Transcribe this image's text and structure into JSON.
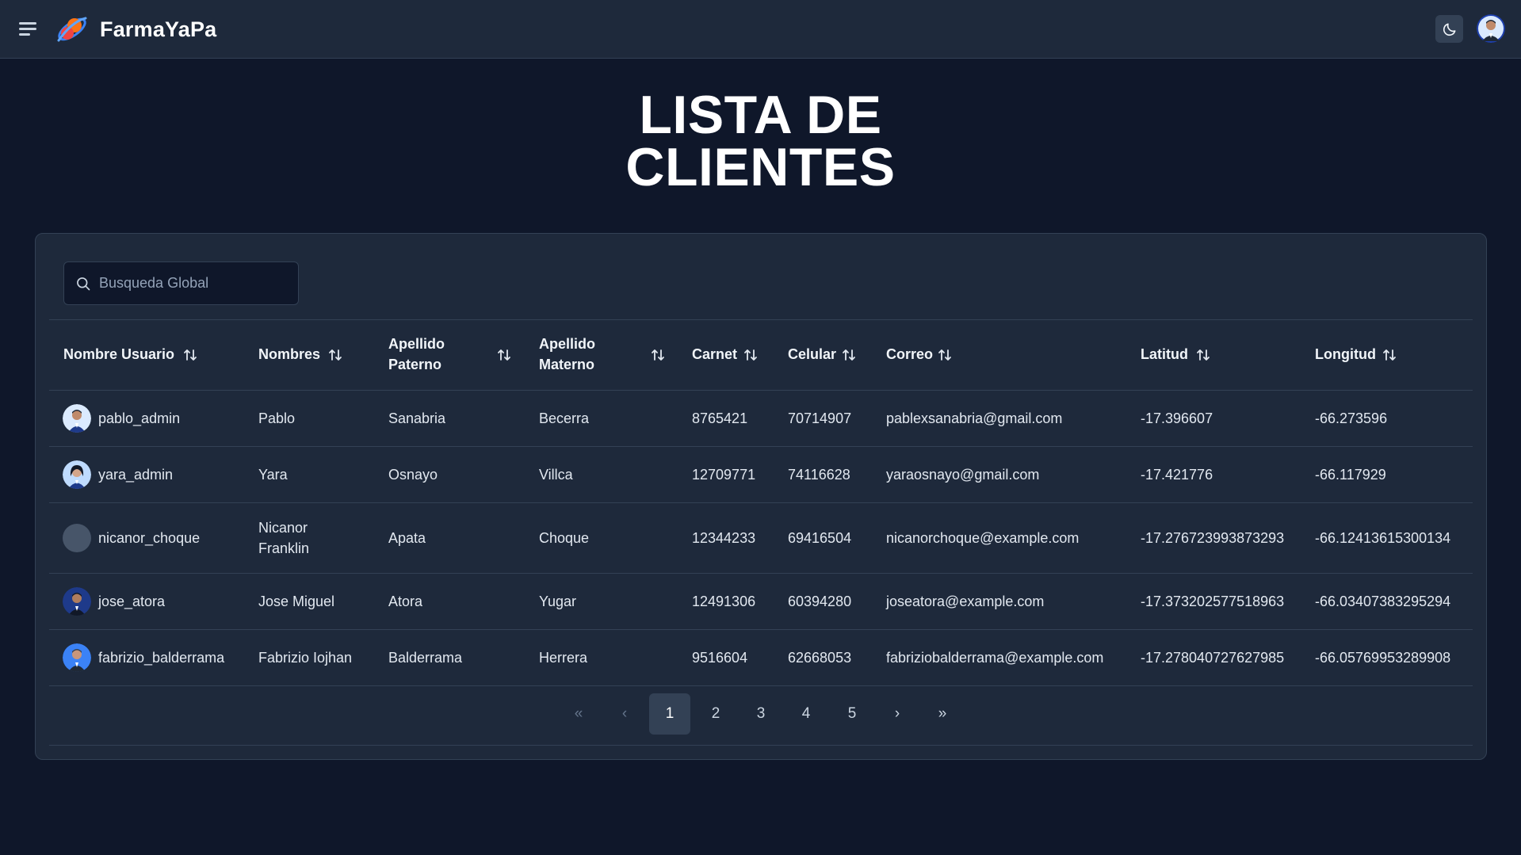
{
  "header": {
    "brand": "FarmaYaPa"
  },
  "title": {
    "line1": "LISTA DE",
    "line2": "CLIENTES"
  },
  "search": {
    "placeholder": "Busqueda Global"
  },
  "table": {
    "columns": [
      {
        "label": "Nombre Usuario"
      },
      {
        "label": "Nombres"
      },
      {
        "label": "Apellido Paterno"
      },
      {
        "label": "Apellido Materno"
      },
      {
        "label": "Carnet"
      },
      {
        "label": "Celular"
      },
      {
        "label": "Correo"
      },
      {
        "label": "Latitud"
      },
      {
        "label": "Longitud"
      }
    ],
    "rows": [
      {
        "usuario": "pablo_admin",
        "nombres": "Pablo",
        "paterno": "Sanabria",
        "materno": "Becerra",
        "carnet": "8765421",
        "celular": "70714907",
        "correo": "pablexsanabria@gmail.com",
        "latitud": "-17.396607",
        "longitud": "-66.273596"
      },
      {
        "usuario": "yara_admin",
        "nombres": "Yara",
        "paterno": "Osnayo",
        "materno": "Villca",
        "carnet": "12709771",
        "celular": "74116628",
        "correo": "yaraosnayo@gmail.com",
        "latitud": "-17.421776",
        "longitud": "-66.117929"
      },
      {
        "usuario": "nicanor_choque",
        "nombres": "Nicanor Franklin",
        "paterno": "Apata",
        "materno": "Choque",
        "carnet": "12344233",
        "celular": "69416504",
        "correo": "nicanorchoque@example.com",
        "latitud": "-17.276723993873293",
        "longitud": "-66.12413615300134"
      },
      {
        "usuario": "jose_atora",
        "nombres": "Jose Miguel",
        "paterno": "Atora",
        "materno": "Yugar",
        "carnet": "12491306",
        "celular": "60394280",
        "correo": "joseatora@example.com",
        "latitud": "-17.373202577518963",
        "longitud": "-66.03407383295294"
      },
      {
        "usuario": "fabrizio_balderrama",
        "nombres": "Fabrizio Iojhan",
        "paterno": "Balderrama",
        "materno": "Herrera",
        "carnet": "9516604",
        "celular": "62668053",
        "correo": "fabriziobalderrama@example.com",
        "latitud": "-17.278040727627985",
        "longitud": "-66.05769953289908"
      }
    ]
  },
  "pagination": {
    "first": "«",
    "prev": "‹",
    "pages": [
      "1",
      "2",
      "3",
      "4",
      "5"
    ],
    "active_page": "1",
    "next": "›",
    "last": "»"
  },
  "icons": {
    "menu": "hamburger-icon",
    "theme": "moon-icon",
    "search": "search-icon",
    "sort": "sort-icon"
  },
  "colors": {
    "background": "#0f172a",
    "surface": "#1e293b",
    "border": "#334155",
    "text": "#e2e8f0"
  }
}
